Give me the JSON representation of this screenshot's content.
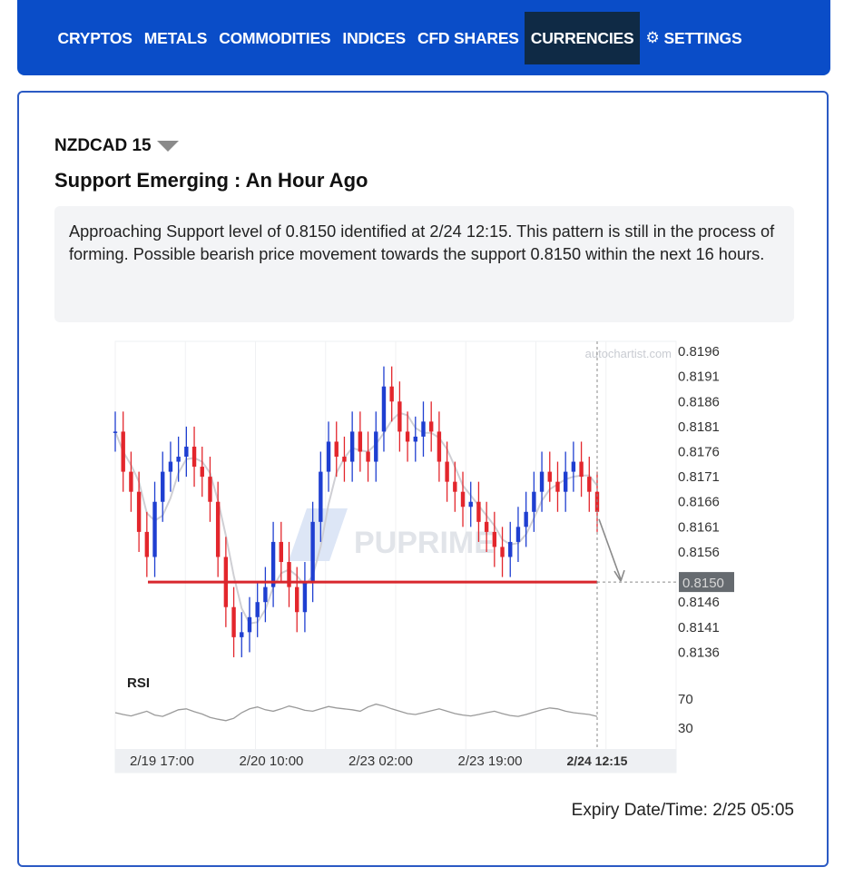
{
  "nav": {
    "items": [
      {
        "label": "CRYPTOS",
        "active": false
      },
      {
        "label": "METALS",
        "active": false
      },
      {
        "label": "COMMODITIES",
        "active": false
      },
      {
        "label": "INDICES",
        "active": false
      },
      {
        "label": "CFD SHARES",
        "active": false
      },
      {
        "label": "CURRENCIES",
        "active": true
      }
    ],
    "settings_label": "SETTINGS",
    "settings_icon": "gear-icon"
  },
  "card": {
    "symbol": "NZDCAD 15",
    "headline": "Support Emerging : An Hour Ago",
    "description": "Approaching Support level of 0.8150 identified at 2/24 12:15. This pattern is still in the process of forming. Possible bearish price movement towards the support 0.8150 within the next 16 hours.",
    "expiry": "Expiry Date/Time: 2/25 05:05"
  },
  "chart_data": {
    "type": "line",
    "watermark": "autochartist.com",
    "brand_watermark": "PUPRIME",
    "support_level": 0.815,
    "support_label": "0.8150",
    "ylim": [
      0.8133,
      0.8198
    ],
    "y_ticks": [
      "0.8196",
      "0.8191",
      "0.8186",
      "0.8181",
      "0.8176",
      "0.8171",
      "0.8166",
      "0.8161",
      "0.8156",
      "0.8146",
      "0.8141",
      "0.8136"
    ],
    "x_ticks": [
      "2/19 17:00",
      "2/20 10:00",
      "2/23 02:00",
      "2/23 19:00",
      "2/24 12:15"
    ],
    "x_tick_positions": [
      0.08,
      0.275,
      0.47,
      0.665,
      0.865
    ],
    "current_marker_label": "2/24 12:15",
    "series": [
      {
        "values": [
          0.818,
          0.8172,
          0.8168,
          0.816,
          0.8155,
          0.8166,
          0.8172,
          0.8174,
          0.8175,
          0.8177,
          0.8173,
          0.8171,
          0.8166,
          0.8155,
          0.8145,
          0.8139,
          0.814,
          0.8143,
          0.8146,
          0.8149,
          0.8158,
          0.8154,
          0.8149,
          0.8144,
          0.815,
          0.8162,
          0.8172,
          0.8178,
          0.8175,
          0.8174,
          0.818,
          0.8176,
          0.8174,
          0.818,
          0.8189,
          0.8186,
          0.818,
          0.8178,
          0.8179,
          0.8182,
          0.818,
          0.8174,
          0.817,
          0.8168,
          0.8165,
          0.8166,
          0.8162,
          0.816,
          0.8157,
          0.8155,
          0.8158,
          0.8161,
          0.8164,
          0.8168,
          0.8172,
          0.817,
          0.8168,
          0.8172,
          0.8174,
          0.8171,
          0.8168,
          0.8164
        ]
      }
    ],
    "rsi": {
      "label": "RSI",
      "levels": [
        "70",
        "30"
      ],
      "values": [
        52,
        48,
        45,
        50,
        55,
        47,
        44,
        51,
        58,
        60,
        54,
        49,
        42,
        38,
        35,
        40,
        52,
        60,
        64,
        58,
        55,
        60,
        66,
        62,
        57,
        55,
        60,
        65,
        62,
        60,
        58,
        55,
        64,
        70,
        66,
        60,
        55,
        50,
        48,
        52,
        56,
        60,
        55,
        50,
        47,
        45,
        48,
        52,
        55,
        50,
        46,
        44,
        48,
        53,
        58,
        62,
        60,
        55,
        52,
        50,
        48,
        44
      ]
    }
  }
}
